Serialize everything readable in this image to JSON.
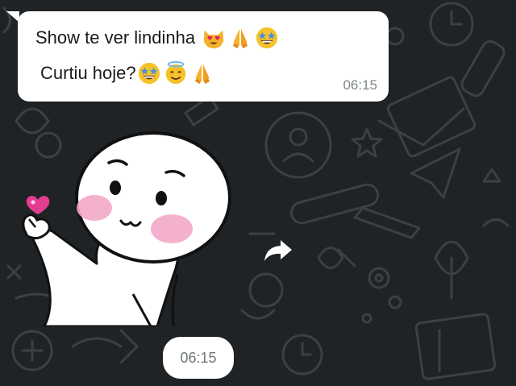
{
  "chat": {
    "background_color": "#1f2326",
    "doodle_color": "#3a3f42"
  },
  "message": {
    "line1_text": "Show te ver lindinha",
    "line1_emojis": [
      "heart-eyes-cat-emoji",
      "folded-hands-emoji",
      "star-struck-emoji"
    ],
    "line2_text": "Curtiu hoje?",
    "line2_emojis": [
      "star-struck-emoji",
      "smiling-face-with-halo-emoji",
      "folded-hands-emoji"
    ],
    "time": "06:15",
    "bubble_color": "#ffffff"
  },
  "sticker": {
    "description_icon": "cute-character-finger-heart-sticker",
    "forward_icon": "forward-arrow-icon"
  },
  "sticker_time": "06:15"
}
